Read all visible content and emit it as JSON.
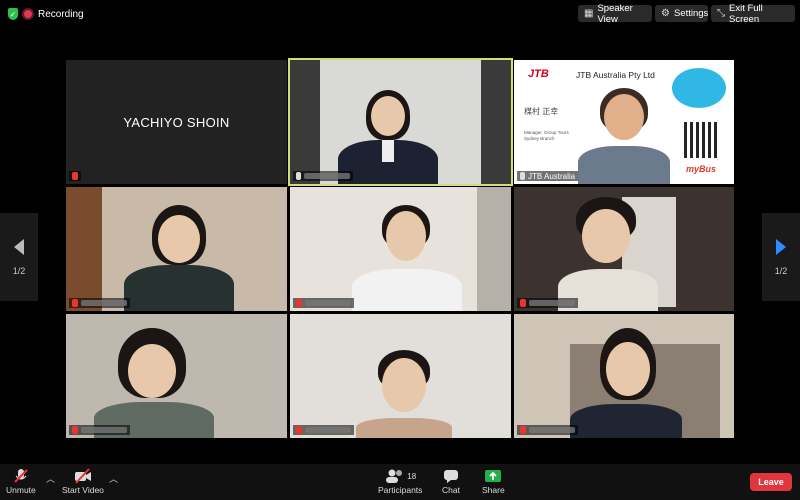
{
  "recording": {
    "label": "Recording"
  },
  "top_buttons": {
    "speaker_view": "Speaker View",
    "settings": "Settings",
    "exit_full_screen": "Exit Full Screen"
  },
  "tiles": {
    "yachiyo": {
      "name": "YACHIYO SHOIN"
    },
    "jtb": {
      "name": "JTB Australia",
      "logo": "JTB",
      "company": "JTB Australia Pty Ltd",
      "person_name": "楳村 正幸",
      "role_line1": "Manager, Group Tours",
      "role_line2": "Sydney Branch",
      "brand": "myBus"
    }
  },
  "paging": {
    "page": "1/2"
  },
  "bottom": {
    "unmute": "Unmute",
    "start_video": "Start Video",
    "participants": "Participants",
    "participants_count": "18",
    "chat": "Chat",
    "share": "Share",
    "leave": "Leave"
  },
  "colors": {
    "active_outline": "#cfe07a",
    "leave": "#e0363e",
    "share": "#22b04a",
    "recording": "#e0384c"
  }
}
